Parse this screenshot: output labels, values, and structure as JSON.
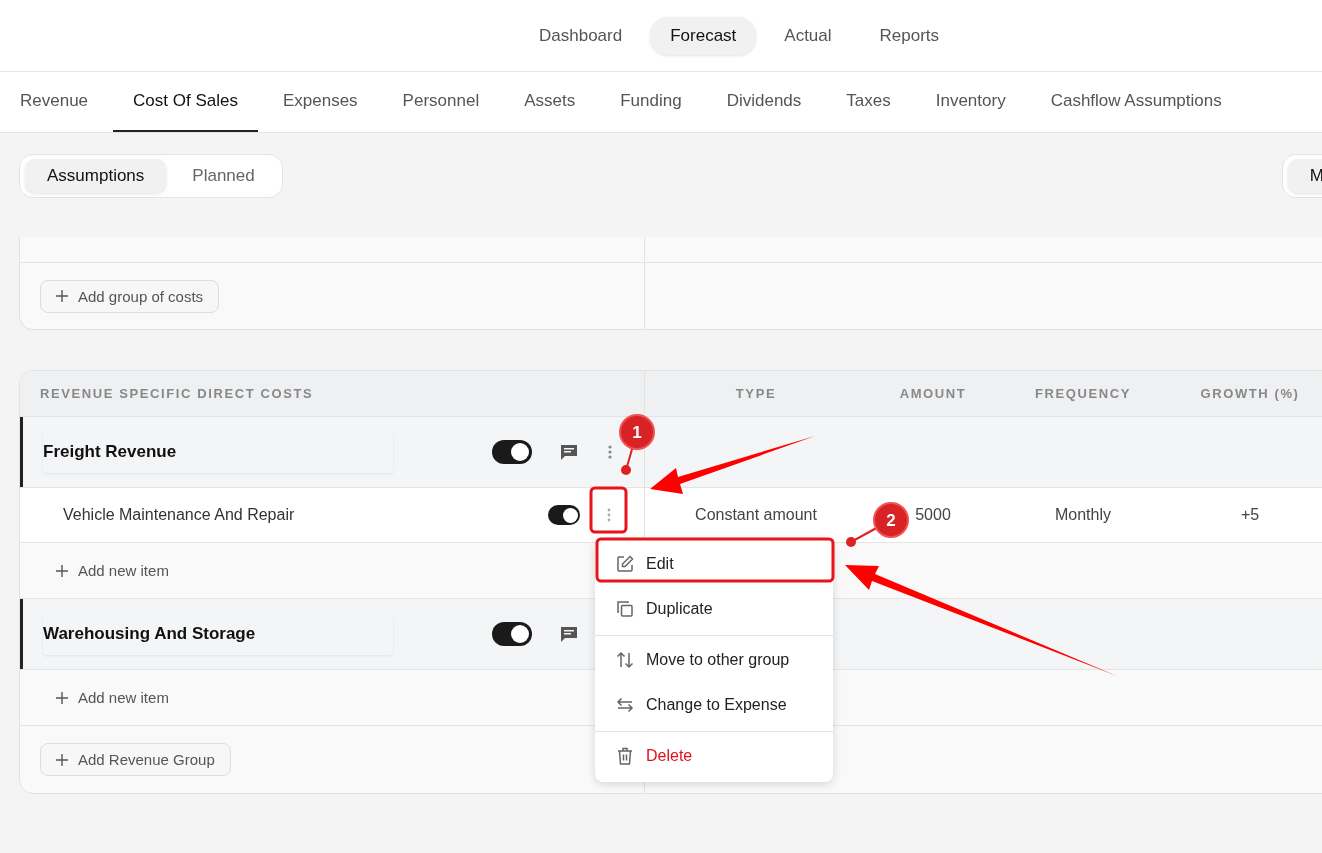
{
  "top_nav": [
    {
      "label": "Dashboard",
      "selected": false
    },
    {
      "label": "Forecast",
      "selected": true
    },
    {
      "label": "Actual",
      "selected": false
    },
    {
      "label": "Reports",
      "selected": false
    }
  ],
  "tabs": [
    {
      "label": "Revenue",
      "selected": false
    },
    {
      "label": "Cost Of Sales",
      "selected": true
    },
    {
      "label": "Expenses",
      "selected": false
    },
    {
      "label": "Personnel",
      "selected": false
    },
    {
      "label": "Assets",
      "selected": false
    },
    {
      "label": "Funding",
      "selected": false
    },
    {
      "label": "Dividends",
      "selected": false
    },
    {
      "label": "Taxes",
      "selected": false
    },
    {
      "label": "Inventory",
      "selected": false
    },
    {
      "label": "Cashflow Assumptions",
      "selected": false
    }
  ],
  "view_switch": [
    {
      "label": "Assumptions",
      "selected": true
    },
    {
      "label": "Planned",
      "selected": false
    }
  ],
  "right_switch": {
    "label": "M",
    "selected": true
  },
  "costs_table": {
    "add_button": "Add group of costs"
  },
  "direct_costs": {
    "columns": [
      "REVENUE SPECIFIC DIRECT COSTS",
      "TYPE",
      "AMOUNT",
      "FREQUENCY",
      "GROWTH (%)"
    ],
    "groups": [
      {
        "name": "Freight Revenue",
        "on": true,
        "add_item": "Add new item",
        "items": [
          {
            "name": "Vehicle Maintenance And Repair",
            "on": true,
            "type": "Constant amount",
            "amount": "5000",
            "frequency": "Monthly",
            "growth": "+5"
          }
        ]
      },
      {
        "name": "Warehousing And Storage",
        "on": true,
        "add_item": "Add new item"
      }
    ],
    "add_group": "Add Revenue Group"
  },
  "context_menu": {
    "sections": [
      {
        "items": [
          {
            "kind": "edit",
            "label": "Edit"
          },
          {
            "kind": "duplicate",
            "label": "Duplicate"
          }
        ]
      },
      {
        "items": [
          {
            "kind": "move",
            "label": "Move to other group"
          },
          {
            "kind": "change",
            "label": "Change to Expense"
          }
        ]
      },
      {
        "items": [
          {
            "kind": "delete",
            "label": "Delete"
          }
        ]
      }
    ]
  },
  "annotations": {
    "callouts": [
      {
        "label": "1"
      },
      {
        "label": "2"
      }
    ]
  }
}
